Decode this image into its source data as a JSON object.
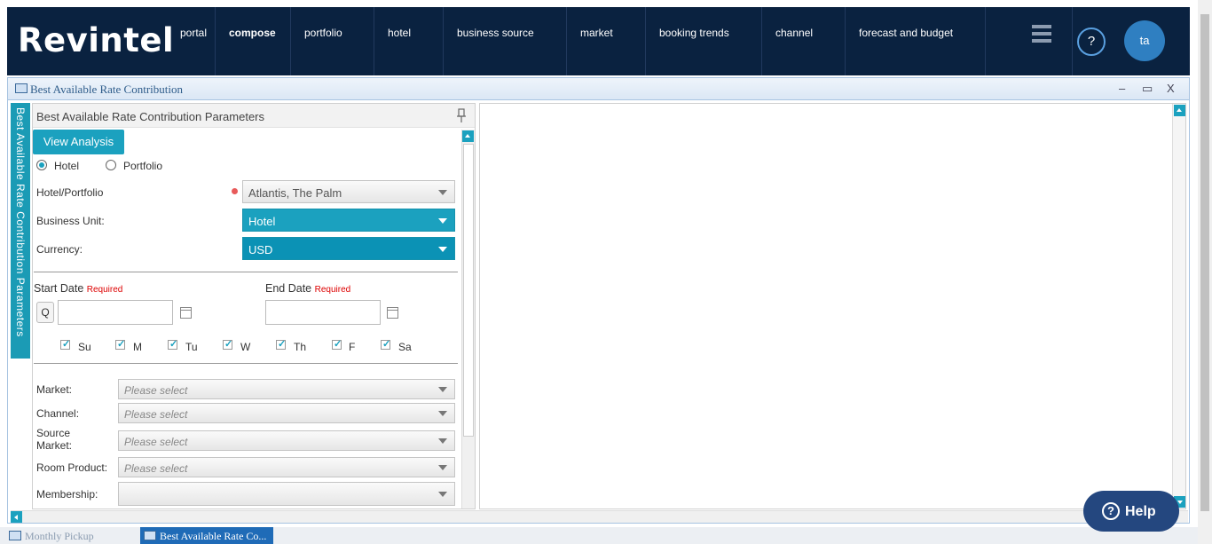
{
  "app": {
    "logo": "Revintel"
  },
  "nav": {
    "items": [
      {
        "label": "portal"
      },
      {
        "label": "compose"
      },
      {
        "label": "portfolio"
      },
      {
        "label": "hotel"
      },
      {
        "label": "business source"
      },
      {
        "label": "market"
      },
      {
        "label": "booking trends"
      },
      {
        "label": "channel"
      },
      {
        "label": "forecast and budget"
      }
    ],
    "help_label": "?",
    "avatar_initials": "ta"
  },
  "window": {
    "title": "Best Available Rate Contribution",
    "minimize": "–",
    "maximize": "▭",
    "close": "X"
  },
  "sidetab": {
    "label": "Best Available Rate Contribution Parameters"
  },
  "panel": {
    "title": "Best Available Rate Contribution Parameters",
    "view_button": "View Analysis",
    "scope": {
      "hotel_label": "Hotel",
      "portfolio_label": "Portfolio",
      "selected": "Hotel"
    },
    "hotel_portfolio": {
      "label": "Hotel/Portfolio",
      "value": "Atlantis, The Palm"
    },
    "business_unit": {
      "label": "Business Unit:",
      "value": "Hotel"
    },
    "currency": {
      "label": "Currency:",
      "value": "USD"
    },
    "start_date": {
      "label": "Start Date",
      "required": "Required",
      "q_button": "Q",
      "value": ""
    },
    "end_date": {
      "label": "End Date",
      "required": "Required",
      "value": ""
    },
    "days": [
      "Su",
      "M",
      "Tu",
      "W",
      "Th",
      "F",
      "Sa"
    ],
    "filters": [
      {
        "label": "Market:",
        "placeholder": "Please select"
      },
      {
        "label": "Channel:",
        "placeholder": "Please select"
      },
      {
        "label": "Source Market:",
        "placeholder": "Please select"
      },
      {
        "label": "Room Product:",
        "placeholder": "Please select"
      },
      {
        "label": "Membership:",
        "placeholder": ""
      }
    ]
  },
  "taskbar": {
    "items": [
      {
        "label": "Monthly Pickup",
        "active": false
      },
      {
        "label": "Best Available Rate Co...",
        "active": true
      }
    ]
  },
  "help_button": {
    "label": "Help"
  }
}
